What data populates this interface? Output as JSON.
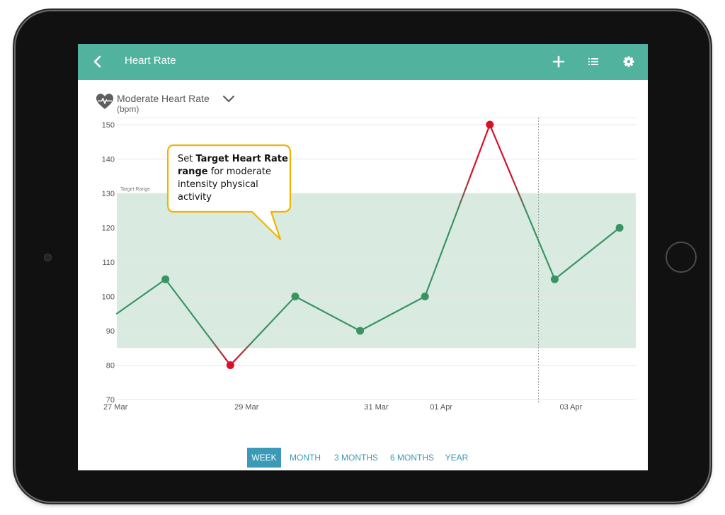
{
  "header": {
    "title": "Heart Rate",
    "back_icon": "chevron-left-icon",
    "actions": [
      "add-icon",
      "list-icon",
      "gear-icon"
    ]
  },
  "metric": {
    "name": "Moderate Heart Rate",
    "unit": "(bpm)",
    "icon": "heart-pulse-icon"
  },
  "callout": {
    "text_before": "Set ",
    "bold_1": "Target Heart",
    "bold_2": "Rate range",
    "text_after": " for moderate intensity physical activity"
  },
  "periods": {
    "items": [
      "WEEK",
      "MONTH",
      "3 MONTHS",
      "6 MONTHS",
      "YEAR"
    ],
    "active": "WEEK"
  },
  "colors": {
    "header": "#51b39e",
    "in_range": "#3a9461",
    "out_of_range": "#d8102a",
    "target_band": "#d9ebe1",
    "period_active": "#3a9ab8"
  },
  "chart_data": {
    "type": "line",
    "ylim": [
      70,
      150
    ],
    "y_ticks": [
      70,
      80,
      90,
      100,
      110,
      120,
      130,
      140,
      150
    ],
    "x_range": [
      "2017-03-27",
      "2017-04-04"
    ],
    "x_tick_labels": [
      {
        "date": "2017-03-27",
        "label": "27 Mar"
      },
      {
        "date": "2017-03-29",
        "label": "29 Mar"
      },
      {
        "date": "2017-03-31",
        "label": "31 Mar"
      },
      {
        "date": "2017-04-01",
        "label": "01 Apr"
      },
      {
        "date": "2017-04-03",
        "label": "03 Apr"
      }
    ],
    "target_range": {
      "label": "Target Range",
      "min": 85,
      "max": 130
    },
    "series": [
      {
        "points": [
          {
            "x": "2017-03-27 00:00",
            "y": 95,
            "marker": false
          },
          {
            "x": "2017-03-27 18:00",
            "y": 105,
            "marker": true
          },
          {
            "x": "2017-03-28 18:00",
            "y": 80,
            "marker": true
          },
          {
            "x": "2017-03-29 18:00",
            "y": 100,
            "marker": true
          },
          {
            "x": "2017-03-30 18:00",
            "y": 90,
            "marker": true
          },
          {
            "x": "2017-03-31 18:00",
            "y": 100,
            "marker": true
          },
          {
            "x": "2017-04-01 18:00",
            "y": 150,
            "marker": true
          },
          {
            "x": "2017-04-02 18:00",
            "y": 105,
            "marker": true
          },
          {
            "x": "2017-04-03 18:00",
            "y": 120,
            "marker": true
          }
        ]
      }
    ],
    "current_marker": "2017-04-02 12:00",
    "grid": true
  }
}
